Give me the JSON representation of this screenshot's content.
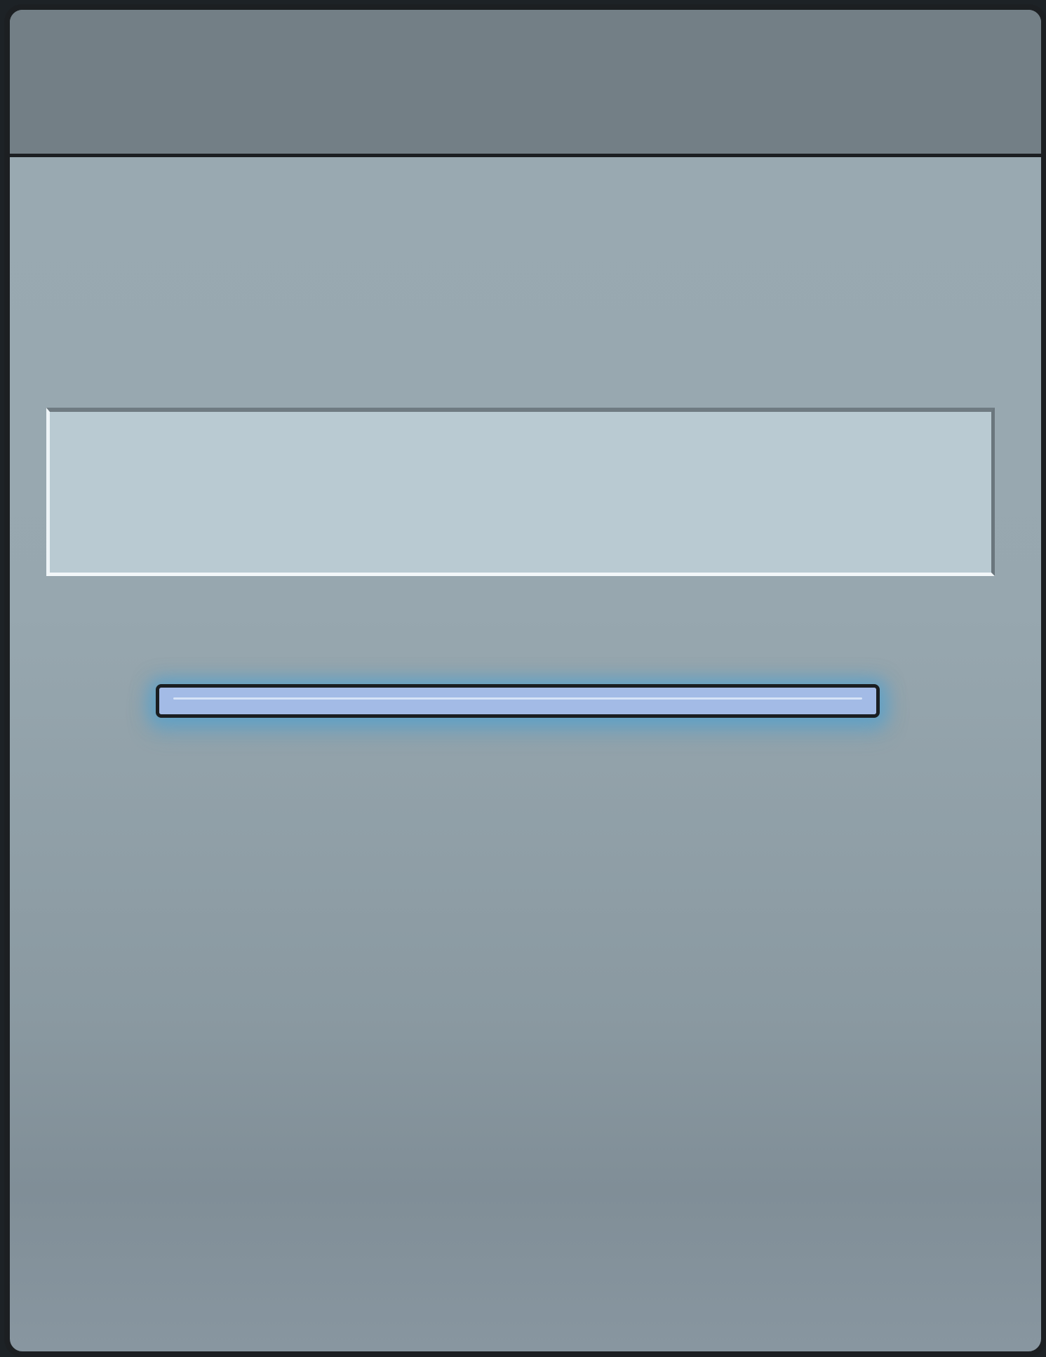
{
  "window": {
    "title": ""
  },
  "text_field": {
    "value": "",
    "placeholder": ""
  },
  "progress": {
    "value_percent": 100
  },
  "colors": {
    "titlebar": "#737f86",
    "frame": "#1c1f22",
    "field_background": "#b9cad2",
    "progress_fill": "#a3bbe6",
    "progress_glow": "#4aa0d2"
  }
}
